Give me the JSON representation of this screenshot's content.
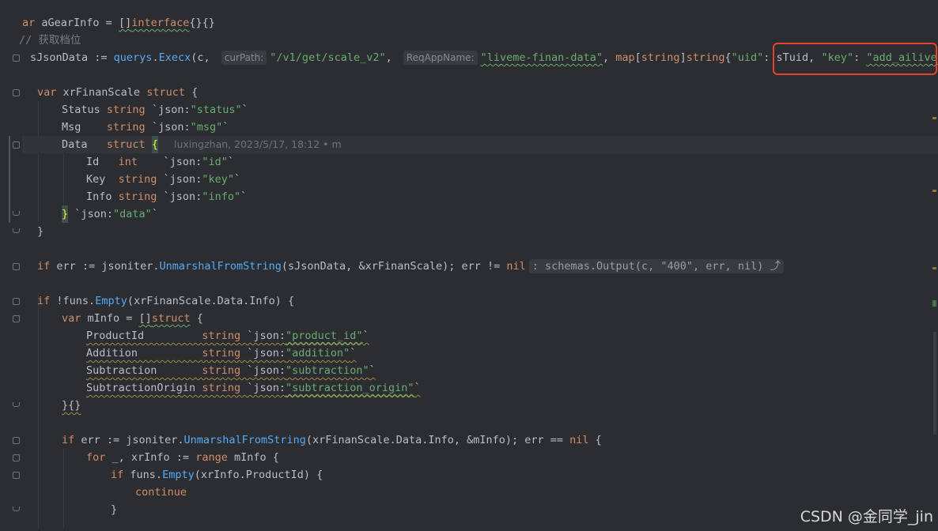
{
  "lines": {
    "l1": {
      "a": "ar",
      "b": " aGearInfo = ",
      "c": "[]",
      "d": "interface",
      "e": "{}{}"
    },
    "l2": {
      "comment": "// 获取档位"
    },
    "l3": {
      "a": "sJsonData := ",
      "b": "querys",
      "c": ".",
      "d": "Execx",
      "e": "(c, ",
      "hint1": "curPath:",
      "s1": "\"/v1/get/scale_v2\"",
      "f": ", ",
      "hint2": "ReqAppName:",
      "s2": "\"liveme-finan-data\"",
      "g": ", ",
      "h": "map",
      "i": "[",
      "j": "string",
      "k": "]",
      "l": "string",
      "m": "{",
      "s3": "\"uid\"",
      "n": ": sTuid, ",
      "s4": "\"key\"",
      "o": ": ",
      "s5": "\"add_ailive_time\""
    },
    "l5": {
      "a": "var",
      "b": " xrFinanScale ",
      "c": "struct",
      "d": " {"
    },
    "l6": {
      "a": "Status ",
      "b": "string",
      "c": " `json:",
      "d": "\"status\"",
      "e": "`"
    },
    "l7": {
      "a": "Msg    ",
      "b": "string",
      "c": " `json:",
      "d": "\"msg\"",
      "e": "`"
    },
    "l8": {
      "a": "Data   ",
      "b": "struct",
      "c": " ",
      "d": "{",
      "blame": "luxingzhan, 2023/5/17, 18:12 • m"
    },
    "l9": {
      "a": "Id   ",
      "b": "int",
      "c": "    `json:",
      "d": "\"id\"",
      "e": "`"
    },
    "l10": {
      "a": "Key  ",
      "b": "string",
      "c": " `json:",
      "d": "\"key\"",
      "e": "`"
    },
    "l11": {
      "a": "Info ",
      "b": "string",
      "c": " `json:",
      "d": "\"info\"",
      "e": "`"
    },
    "l12": {
      "a": "}",
      "b": " `json:",
      "c": "\"data\"",
      "d": "`"
    },
    "l13": {
      "a": "}"
    },
    "l15": {
      "a": "if",
      "b": " err := ",
      "c": "jsoniter",
      "d": ".",
      "e": "UnmarshalFromString",
      "f": "(sJsonData, &xrFinanScale); err != ",
      "g": "nil",
      "folded": ": schemas.Output(c, \"400\", err, nil) ⤴"
    },
    "l17": {
      "a": "if",
      "b": " !",
      "c": "funs",
      "d": ".",
      "e": "Empty",
      "f": "(xrFinanScale.Data.Info) {"
    },
    "l18": {
      "a": "var",
      "b": " mInfo = ",
      "c": "[]",
      "d": "struct",
      "e": " {"
    },
    "l19": {
      "a": "ProductId         ",
      "b": "string",
      "c": " `json:",
      "d": "\"product_id\"",
      "e": "`"
    },
    "l20": {
      "a": "Addition          ",
      "b": "string",
      "c": " `json:",
      "d": "\"addition\"",
      "e": "`"
    },
    "l21": {
      "a": "Subtraction       ",
      "b": "string",
      "c": " `json:",
      "d": "\"subtraction\"",
      "e": "`"
    },
    "l22": {
      "a": "SubtractionOrigin ",
      "b": "string",
      "c": " `json:",
      "d": "\"subtraction_origin\"",
      "e": "`"
    },
    "l23": {
      "a": "}{}"
    },
    "l25": {
      "a": "if",
      "b": " err := ",
      "c": "jsoniter",
      "d": ".",
      "e": "UnmarshalFromString",
      "f": "(xrFinanScale.Data.Info, &mInfo); err == ",
      "g": "nil",
      "h": " {"
    },
    "l26": {
      "a": "for",
      "b": " _, xrInfo := ",
      "c": "range",
      "d": " mInfo {"
    },
    "l27": {
      "a": "if",
      "b": " ",
      "c": "funs",
      "d": ".",
      "e": "Empty",
      "f": "(xrInfo.ProductId) {"
    },
    "l28": {
      "a": "continue"
    },
    "l29": {
      "a": "}"
    }
  },
  "watermark": "CSDN @金同学_jin",
  "colors": {
    "keyword": "#cf8e6d",
    "string": "#6aab73",
    "function": "#56a8f5",
    "highlight": "#e2432f"
  }
}
